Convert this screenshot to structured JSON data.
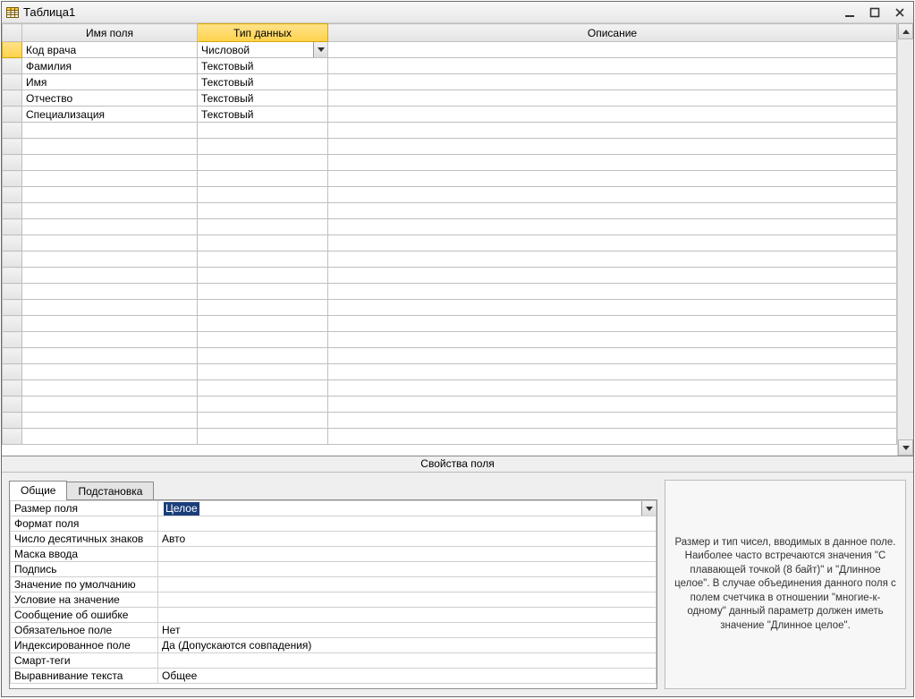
{
  "window": {
    "title": "Таблица1"
  },
  "grid": {
    "headers": {
      "field_name": "Имя поля",
      "data_type": "Тип данных",
      "description": "Описание"
    },
    "rows": [
      {
        "name": "Код врача",
        "type": "Числовой",
        "selected": true
      },
      {
        "name": "Фамилия",
        "type": "Текстовый"
      },
      {
        "name": "Имя",
        "type": "Текстовый"
      },
      {
        "name": "Отчество",
        "type": "Текстовый"
      },
      {
        "name": "Специализация",
        "type": "Текстовый"
      }
    ]
  },
  "section_label": "Свойства поля",
  "tabs": {
    "general": "Общие",
    "lookup": "Подстановка"
  },
  "properties": [
    {
      "label": "Размер поля",
      "value": "Целое",
      "selected": true,
      "dropdown": true
    },
    {
      "label": "Формат поля",
      "value": ""
    },
    {
      "label": "Число десятичных знаков",
      "value": "Авто"
    },
    {
      "label": "Маска ввода",
      "value": ""
    },
    {
      "label": "Подпись",
      "value": ""
    },
    {
      "label": "Значение по умолчанию",
      "value": ""
    },
    {
      "label": "Условие на значение",
      "value": ""
    },
    {
      "label": "Сообщение об ошибке",
      "value": ""
    },
    {
      "label": "Обязательное поле",
      "value": "Нет"
    },
    {
      "label": "Индексированное поле",
      "value": "Да (Допускаются совпадения)"
    },
    {
      "label": "Смарт-теги",
      "value": ""
    },
    {
      "label": "Выравнивание текста",
      "value": "Общее"
    }
  ],
  "help_text": "Размер и тип чисел, вводимых в данное поле. Наиболее часто встречаются значения \"С плавающей точкой (8 байт)\" и \"Длинное целое\". В случае объединения данного поля с полем счетчика в отношении \"многие-к-одному\" данный параметр должен иметь значение \"Длинное целое\"."
}
